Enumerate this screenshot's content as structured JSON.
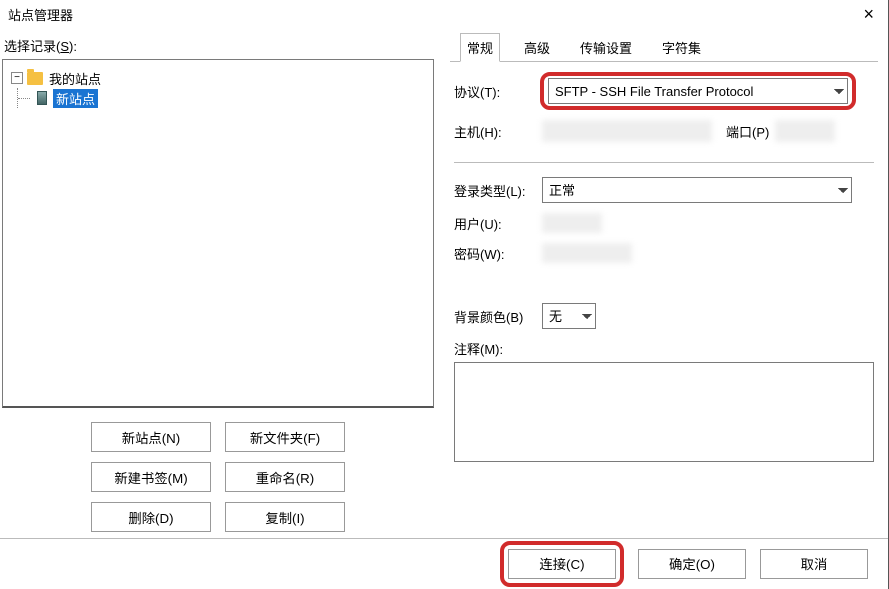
{
  "window": {
    "title": "站点管理器",
    "close": "×"
  },
  "left": {
    "label_prefix": "选择记录(",
    "label_key": "S",
    "label_suffix": "):",
    "tree": {
      "root": "我的站点",
      "site": "新站点"
    },
    "buttons": {
      "new_site": "新站点(N)",
      "new_folder": "新文件夹(F)",
      "new_bookmark": "新建书签(M)",
      "rename": "重命名(R)",
      "delete": "删除(D)",
      "copy": "复制(I)"
    }
  },
  "tabs": {
    "general": "常规",
    "advanced": "高级",
    "transfer": "传输设置",
    "charset": "字符集"
  },
  "form": {
    "protocol_label": "协议(T):",
    "protocol_value": "SFTP - SSH File Transfer Protocol",
    "host_label": "主机(H):",
    "port_label": "端口(P)",
    "logon_label": "登录类型(L):",
    "logon_value": "正常",
    "user_label": "用户(U):",
    "pass_label": "密码(W):",
    "bgcolor_label": "背景颜色(B)",
    "bgcolor_value": "无",
    "note_label": "注释(M):"
  },
  "bottom": {
    "connect": "连接(C)",
    "ok": "确定(O)",
    "cancel": "取消"
  }
}
